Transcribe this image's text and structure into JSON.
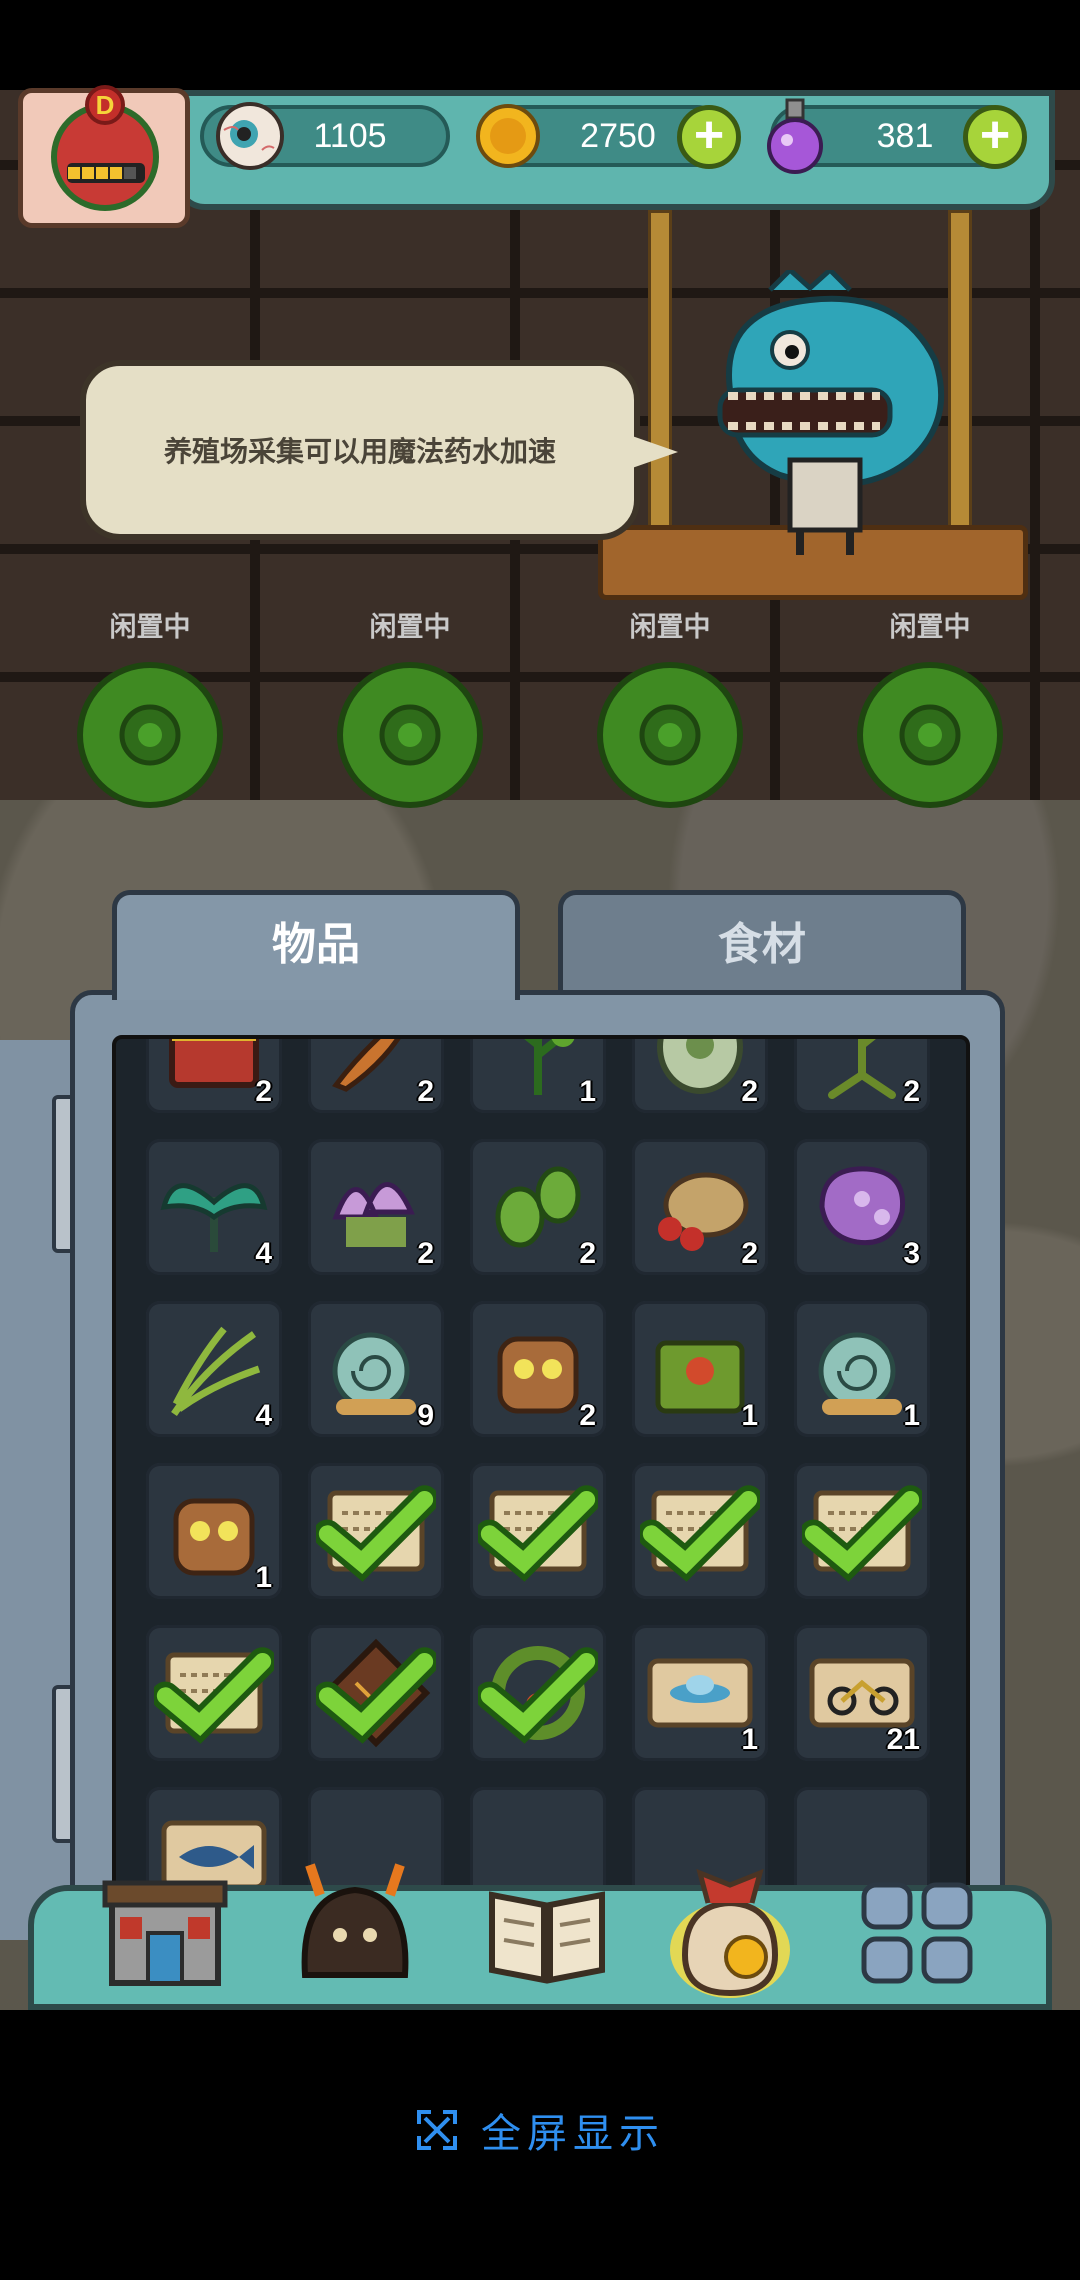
{
  "resources": {
    "eyeballs": "1105",
    "coins": "2750",
    "potions": "381"
  },
  "player": {
    "rank_badge": "D"
  },
  "speech_text": "养殖场采集可以用魔法药水加速",
  "plots": [
    {
      "label": "闲置中"
    },
    {
      "label": "闲置中"
    },
    {
      "label": "闲置中"
    },
    {
      "label": "闲置中"
    }
  ],
  "tabs": {
    "items": "物品",
    "ingredients": "食材"
  },
  "inventory": [
    {
      "icon": "treasure-chest-icon",
      "qty": "2"
    },
    {
      "icon": "feather-icon",
      "qty": "2"
    },
    {
      "icon": "herb-sprig-icon",
      "qty": "1"
    },
    {
      "icon": "green-egg-icon",
      "qty": "2"
    },
    {
      "icon": "root-weed-icon",
      "qty": "2"
    },
    {
      "icon": "teal-leaf-plant-icon",
      "qty": "4"
    },
    {
      "icon": "purple-mushroom-icon",
      "qty": "2"
    },
    {
      "icon": "green-sprout-icon",
      "qty": "2"
    },
    {
      "icon": "bug-seed-icon",
      "qty": "2"
    },
    {
      "icon": "purple-bloom-icon",
      "qty": "3"
    },
    {
      "icon": "grass-bundle-icon",
      "qty": "4"
    },
    {
      "icon": "snail-creature-icon",
      "qty": "9"
    },
    {
      "icon": "stump-creature-icon",
      "qty": "2"
    },
    {
      "icon": "mossy-chest-icon",
      "qty": "1"
    },
    {
      "icon": "snail-creature-icon",
      "qty": "1"
    },
    {
      "icon": "stump-creature-icon",
      "qty": "1"
    },
    {
      "icon": "recipe-scroll-icon",
      "qty": "",
      "checked": true
    },
    {
      "icon": "recipe-scroll-icon",
      "qty": "",
      "checked": true
    },
    {
      "icon": "recipe-scroll-icon",
      "qty": "",
      "checked": true
    },
    {
      "icon": "recipe-scroll-icon",
      "qty": "",
      "checked": true
    },
    {
      "icon": "recipe-scroll-icon",
      "qty": "",
      "checked": true
    },
    {
      "icon": "cracked-tile-icon",
      "qty": "",
      "checked": true
    },
    {
      "icon": "vine-ring-icon",
      "qty": "",
      "checked": true
    },
    {
      "icon": "ufo-ticket-icon",
      "qty": "1"
    },
    {
      "icon": "motorbike-ticket-icon",
      "qty": "21"
    },
    {
      "icon": "fish-ticket-icon",
      "qty": ""
    },
    {
      "icon": "empty-slot",
      "qty": ""
    },
    {
      "icon": "empty-slot",
      "qty": ""
    },
    {
      "icon": "empty-slot",
      "qty": ""
    },
    {
      "icon": "empty-slot",
      "qty": ""
    }
  ],
  "nav": [
    {
      "icon": "shop-icon"
    },
    {
      "icon": "monster-hut-icon"
    },
    {
      "icon": "book-icon"
    },
    {
      "icon": "bag-icon",
      "active": true
    },
    {
      "icon": "more-grid-icon"
    }
  ],
  "fullscreen_label": "全屏显示",
  "colors": {
    "teal_bar": "#5fb5ae",
    "panel": "#8295a6",
    "slot": "#2c3640",
    "plus_green": "#a7d43a",
    "link_blue": "#2f8ff0"
  }
}
